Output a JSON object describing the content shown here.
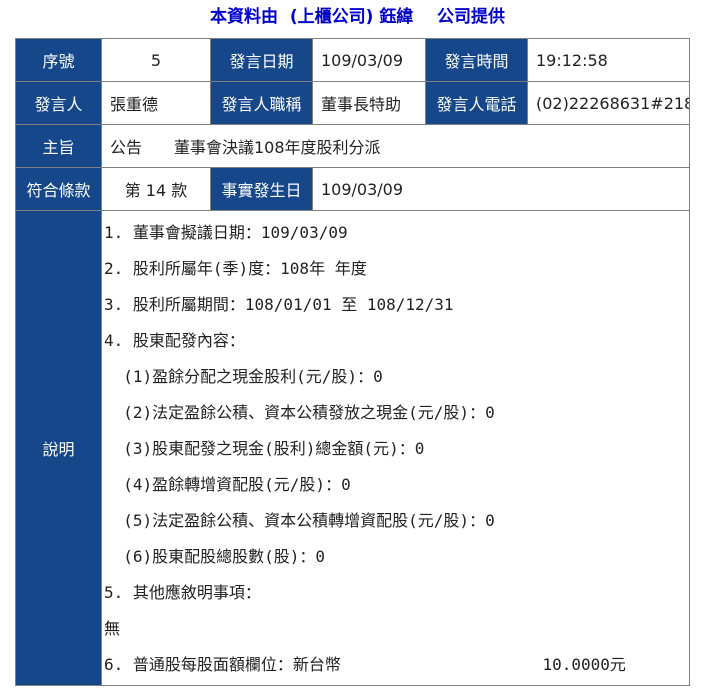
{
  "header": {
    "prefix": "本資料由",
    "company_type": "(上櫃公司)",
    "company_name": "鈺緯",
    "suffix": "公司提供"
  },
  "row1": {
    "seq_label": "序號",
    "seq_value": "5",
    "date_label": "發言日期",
    "date_value": "109/03/09",
    "time_label": "發言時間",
    "time_value": "19:12:58"
  },
  "row2": {
    "speaker_label": "發言人",
    "speaker_value": "張重德",
    "title_label": "發言人職稱",
    "title_value": "董事長特助",
    "phone_label": "發言人電話",
    "phone_value": "(02)22268631#218"
  },
  "row3": {
    "subject_label": "主旨",
    "subject_value": "公告　　董事會決議108年度股利分派"
  },
  "row4": {
    "clause_label": "符合條款",
    "clause_value": "第 14 款",
    "event_date_label": "事實發生日",
    "event_date_value": "109/03/09"
  },
  "description": {
    "label": "說明",
    "lines": [
      "1. 董事會擬議日期：109/03/09",
      "2. 股利所屬年(季)度：108年 年度",
      "3. 股利所屬期間：108/01/01 至 108/12/31",
      "4. 股東配發內容：",
      "  (1)盈餘分配之現金股利(元/股)：0",
      "  (2)法定盈餘公積、資本公積發放之現金(元/股)：0",
      "  (3)股東配發之現金(股利)總金額(元)：0",
      "  (4)盈餘轉增資配股(元/股)：0",
      "  (5)法定盈餘公積、資本公積轉增資配股(元/股)：0",
      "  (6)股東配股總股數(股)：0",
      "5. 其他應敘明事項：",
      "無"
    ],
    "last_line": "6. 普通股每股面額欄位：新台幣",
    "last_amount": "10.0000元"
  }
}
